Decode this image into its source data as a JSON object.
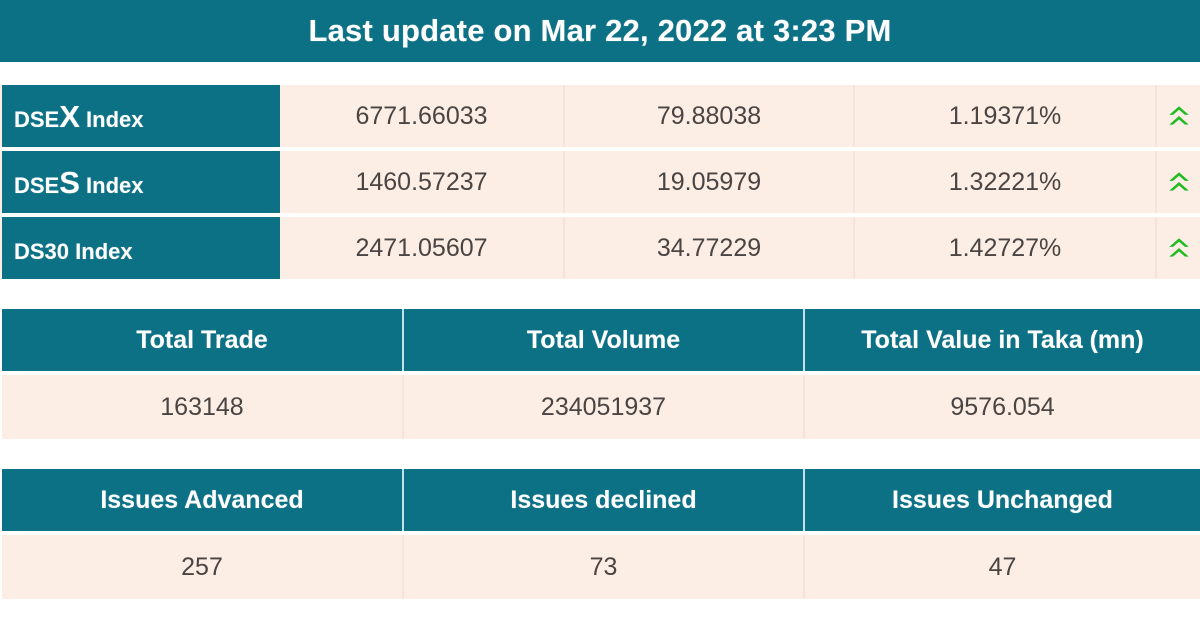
{
  "header": {
    "title": "Last update on Mar 22, 2022 at 3:23 PM"
  },
  "colors": {
    "teal": "#0d7186",
    "cream": "#fdeee5",
    "value_text": "#4a4442",
    "arrow_green": "#22bb22",
    "page_background": "#ffffff"
  },
  "index_table": {
    "rows": [
      {
        "label_prefix": "DSE",
        "label_big": "X",
        "label_suffix": " Index",
        "label_full": "DSEX Index",
        "value": "6771.66033",
        "change": "79.88038",
        "percent": "1.19371%",
        "direction_icon": "double-chevron-up-icon",
        "direction": "up"
      },
      {
        "label_prefix": "DSE",
        "label_big": "S",
        "label_suffix": " Index",
        "label_full": "DSES Index",
        "value": "1460.57237",
        "change": "19.05979",
        "percent": "1.32221%",
        "direction_icon": "double-chevron-up-icon",
        "direction": "up"
      },
      {
        "label_prefix": "DS30",
        "label_big": "",
        "label_suffix": " Index",
        "label_full": "DS30 Index",
        "value": "2471.05607",
        "change": "34.77229",
        "percent": "1.42727%",
        "direction_icon": "double-chevron-up-icon",
        "direction": "up"
      }
    ]
  },
  "trade_table": {
    "headers": [
      "Total Trade",
      "Total Volume",
      "Total Value in Taka (mn)"
    ],
    "values": [
      "163148",
      "234051937",
      "9576.054"
    ]
  },
  "issues_table": {
    "headers": [
      "Issues Advanced",
      "Issues declined",
      "Issues Unchanged"
    ],
    "values": [
      "257",
      "73",
      "47"
    ]
  }
}
